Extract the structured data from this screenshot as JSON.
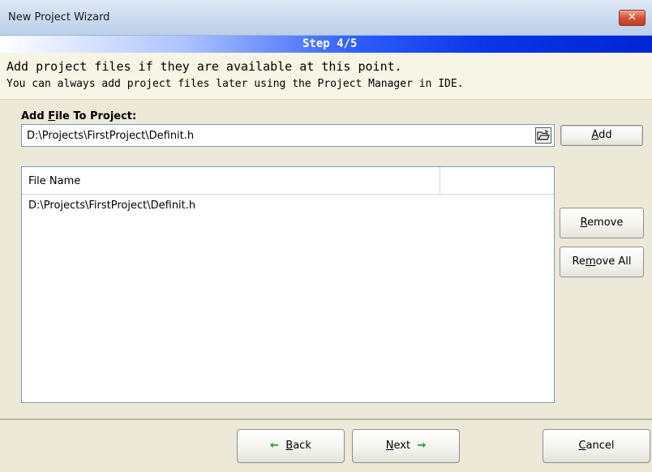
{
  "window": {
    "title": "New Project Wizard",
    "close_label": "✕"
  },
  "step": {
    "label": "Step 4/5"
  },
  "description": {
    "line1": "Add project files if they are available at this point.",
    "line2": "You can always add project files later using the Project Manager in IDE."
  },
  "add_section": {
    "label_prefix": "Add ",
    "label_mnemonic": "F",
    "label_suffix": "ile To Project:",
    "path_value": "D:\\Projects\\FirstProject\\Definit.h",
    "browse_icon": "open-folder-icon",
    "add_mnemonic": "A",
    "add_rest": "dd"
  },
  "file_list": {
    "columns": [
      "File Name",
      ""
    ],
    "rows": [
      "D:\\Projects\\FirstProject\\Definit.h"
    ]
  },
  "side_buttons": {
    "remove_mnemonic": "R",
    "remove_rest": "emove",
    "removeall_prefix": "Re",
    "removeall_mnemonic": "m",
    "removeall_rest": "ove All"
  },
  "footer": {
    "back_mnemonic": "B",
    "back_rest": "ack",
    "next_mnemonic": "N",
    "next_rest": "ext",
    "cancel_mnemonic": "C",
    "cancel_rest": "ancel"
  },
  "colors": {
    "step_bar_blue": "#0a34e8",
    "arrow_green": "#1a9a1a",
    "close_red": "#c23a1f"
  }
}
